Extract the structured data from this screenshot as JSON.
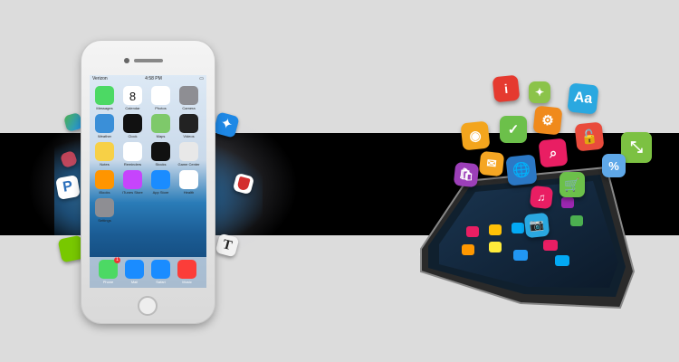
{
  "iphone": {
    "carrier": "Verizon",
    "time": "4:58 PM",
    "apps": [
      {
        "label": "Messages",
        "color": "#4cd964"
      },
      {
        "label": "Calendar",
        "color": "#ffffff"
      },
      {
        "label": "Photos",
        "color": "#ffffff"
      },
      {
        "label": "Camera",
        "color": "#8e8e93"
      },
      {
        "label": "Weather",
        "color": "#3a8fd8"
      },
      {
        "label": "Clock",
        "color": "#111111"
      },
      {
        "label": "Maps",
        "color": "#7ec96a"
      },
      {
        "label": "Videos",
        "color": "#222222"
      },
      {
        "label": "Notes",
        "color": "#f7d046"
      },
      {
        "label": "Reminders",
        "color": "#ffffff"
      },
      {
        "label": "Stocks",
        "color": "#111111"
      },
      {
        "label": "Game Center",
        "color": "#e8e8e8"
      },
      {
        "label": "iBooks",
        "color": "#ff9500"
      },
      {
        "label": "iTunes Store",
        "color": "#c644fc"
      },
      {
        "label": "App Store",
        "color": "#1a8cff"
      },
      {
        "label": "Health",
        "color": "#ffffff"
      },
      {
        "label": "Settings",
        "color": "#8e8e93"
      }
    ],
    "calendar_day": "8",
    "dock": [
      {
        "label": "Phone",
        "color": "#4cd964",
        "badge": "1"
      },
      {
        "label": "Mail",
        "color": "#1a8cff"
      },
      {
        "label": "Safari",
        "color": "#1a8cff"
      },
      {
        "label": "Music",
        "color": "#fc3d39"
      }
    ]
  },
  "floating_left_icons": [
    "maps-icon",
    "game-icon",
    "pandora-icon",
    "duolingo-icon",
    "fitness-icon",
    "nfl-icon",
    "nyt-icon"
  ],
  "android_cubes": [
    {
      "icon": "info-icon",
      "glyph": "i",
      "color": "#e53a2f"
    },
    {
      "icon": "sparkle-icon",
      "glyph": "✦",
      "color": "#8bc34a"
    },
    {
      "icon": "font-icon",
      "glyph": "Aa",
      "color": "#2aa8e0"
    },
    {
      "icon": "rss-icon",
      "glyph": "◉",
      "color": "#f3a51d"
    },
    {
      "icon": "check-icon",
      "glyph": "✓",
      "color": "#6cc04a"
    },
    {
      "icon": "gear-icon",
      "glyph": "⚙",
      "color": "#f08a1c"
    },
    {
      "icon": "lock-icon",
      "glyph": "🔓",
      "color": "#e94b3c"
    },
    {
      "icon": "compress-icon",
      "glyph": "⤡",
      "color": "#7cc142"
    },
    {
      "icon": "mail-icon",
      "glyph": "✉",
      "color": "#f5a623"
    },
    {
      "icon": "search-icon",
      "glyph": "⌕",
      "color": "#e91e63"
    },
    {
      "icon": "percent-icon",
      "glyph": "%",
      "color": "#5fa8e8"
    },
    {
      "icon": "bag-icon",
      "glyph": "🛍",
      "color": "#9c3fb8"
    },
    {
      "icon": "globe-icon",
      "glyph": "🌐",
      "color": "#2b78c5"
    },
    {
      "icon": "cart-icon",
      "glyph": "🛒",
      "color": "#6cc04a"
    },
    {
      "icon": "music-icon",
      "glyph": "♫",
      "color": "#e91e63"
    },
    {
      "icon": "camera-icon",
      "glyph": "📷",
      "color": "#2aa8e0"
    }
  ]
}
